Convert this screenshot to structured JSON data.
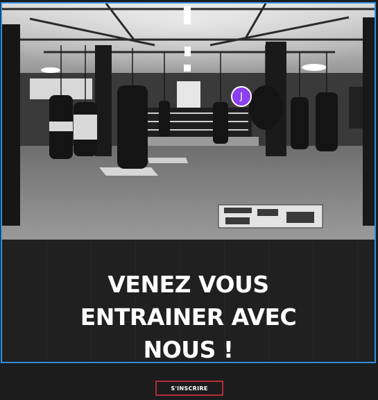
{
  "hero": {
    "heading_lines": [
      "VENEZ VOUS",
      "ENTRAINER AVEC",
      "NOUS !"
    ]
  },
  "presence_avatar": {
    "initial": "J"
  },
  "cta": {
    "label": "S'INSCRIRE"
  },
  "colors": {
    "selection_outline": "#2f8fe0",
    "cta_border": "#b52b38",
    "avatar_bg": "#8a3ff0",
    "section_bg": "#1c1c1c"
  }
}
